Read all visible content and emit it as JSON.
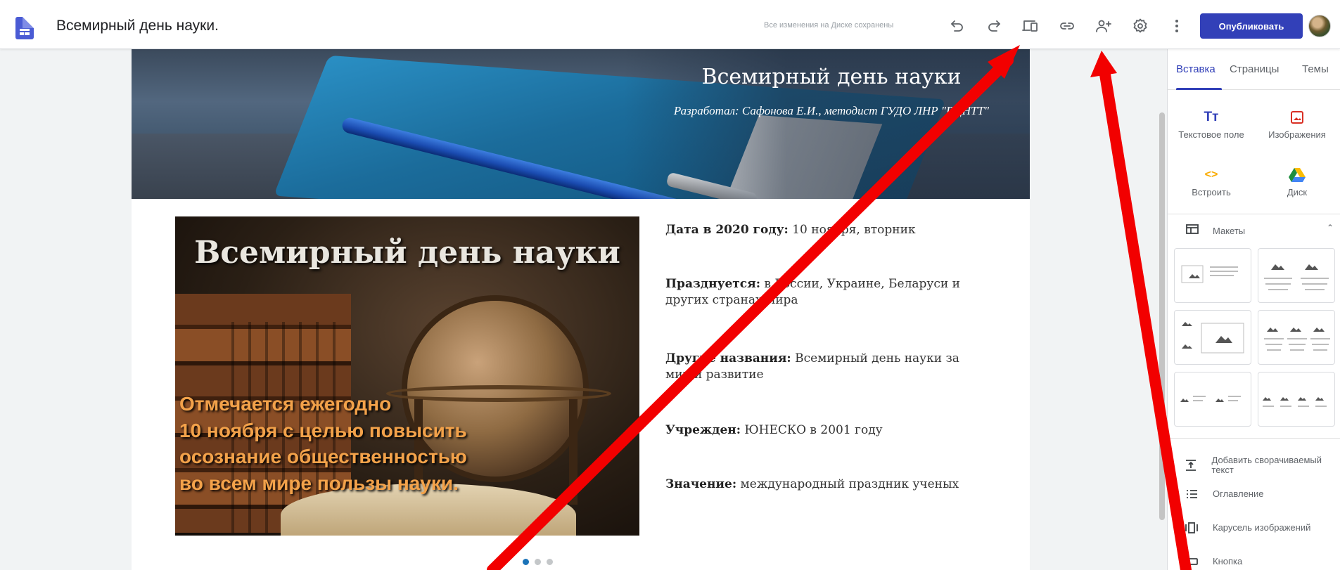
{
  "topbar": {
    "site_title": "Всемирный день науки.",
    "save_status": "Все изменения на Диске сохранены",
    "publish_label": "Опубликовать"
  },
  "icons": {
    "doc": "google-sites-icon",
    "undo": "undo-icon",
    "redo": "redo-icon",
    "preview": "preview-devices-icon",
    "link": "link-icon",
    "share": "add-person-icon",
    "settings": "gear-icon",
    "more": "more-vert-icon"
  },
  "banner": {
    "title": "Всемирный день науки",
    "subtitle": "Разработал: Сафонова Е.И., методист ГУДО ЛНР \"РЦНТТ\""
  },
  "picture": {
    "title": "Всемирный день науки",
    "caption_lines": [
      "Отмечается ежегодно",
      "10 ноября с целью повысить",
      "осознание общественностью",
      "во всем мире пользы науки."
    ]
  },
  "facts": [
    {
      "label": "Дата в 2020 году:",
      "value": " 10 ноября, вторник"
    },
    {
      "label": "Празднуется:",
      "value": " в России, Украине, Беларуси и других странах мира"
    },
    {
      "label": "Другие названия:",
      "value": " Всемирный день науки за мир и развитие"
    },
    {
      "label": "Учрежден:",
      "value": " ЮНЕСКО в 2001 году"
    },
    {
      "label": "Значение:",
      "value": " международный праздник ученых"
    }
  ],
  "carousel": {
    "dots": 3,
    "active_index": 0
  },
  "panel": {
    "tabs": [
      "Вставка",
      "Страницы",
      "Темы"
    ],
    "active_tab": 0,
    "insert_items": [
      {
        "label": "Текстовое поле",
        "glyph": "Tт",
        "icon": "text-box-icon",
        "color": "#3240b8"
      },
      {
        "label": "Изображения",
        "glyph": "",
        "icon": "image-icon",
        "color": "#d93025"
      },
      {
        "label": "Встроить",
        "glyph": "<>",
        "icon": "embed-icon",
        "color": "#f9ab00"
      },
      {
        "label": "Диск",
        "glyph": "",
        "icon": "drive-icon",
        "color": "#1e8e3e"
      }
    ],
    "layouts_label": "Макеты",
    "components": [
      {
        "label": "Добавить сворачиваемый текст",
        "icon": "collapsible-text-icon"
      },
      {
        "label": "Оглавление",
        "icon": "table-of-contents-icon"
      },
      {
        "label": "Карусель изображений",
        "icon": "image-carousel-icon"
      },
      {
        "label": "Кнопка",
        "icon": "button-icon"
      }
    ]
  },
  "annotation": {
    "color": "#f20000"
  }
}
